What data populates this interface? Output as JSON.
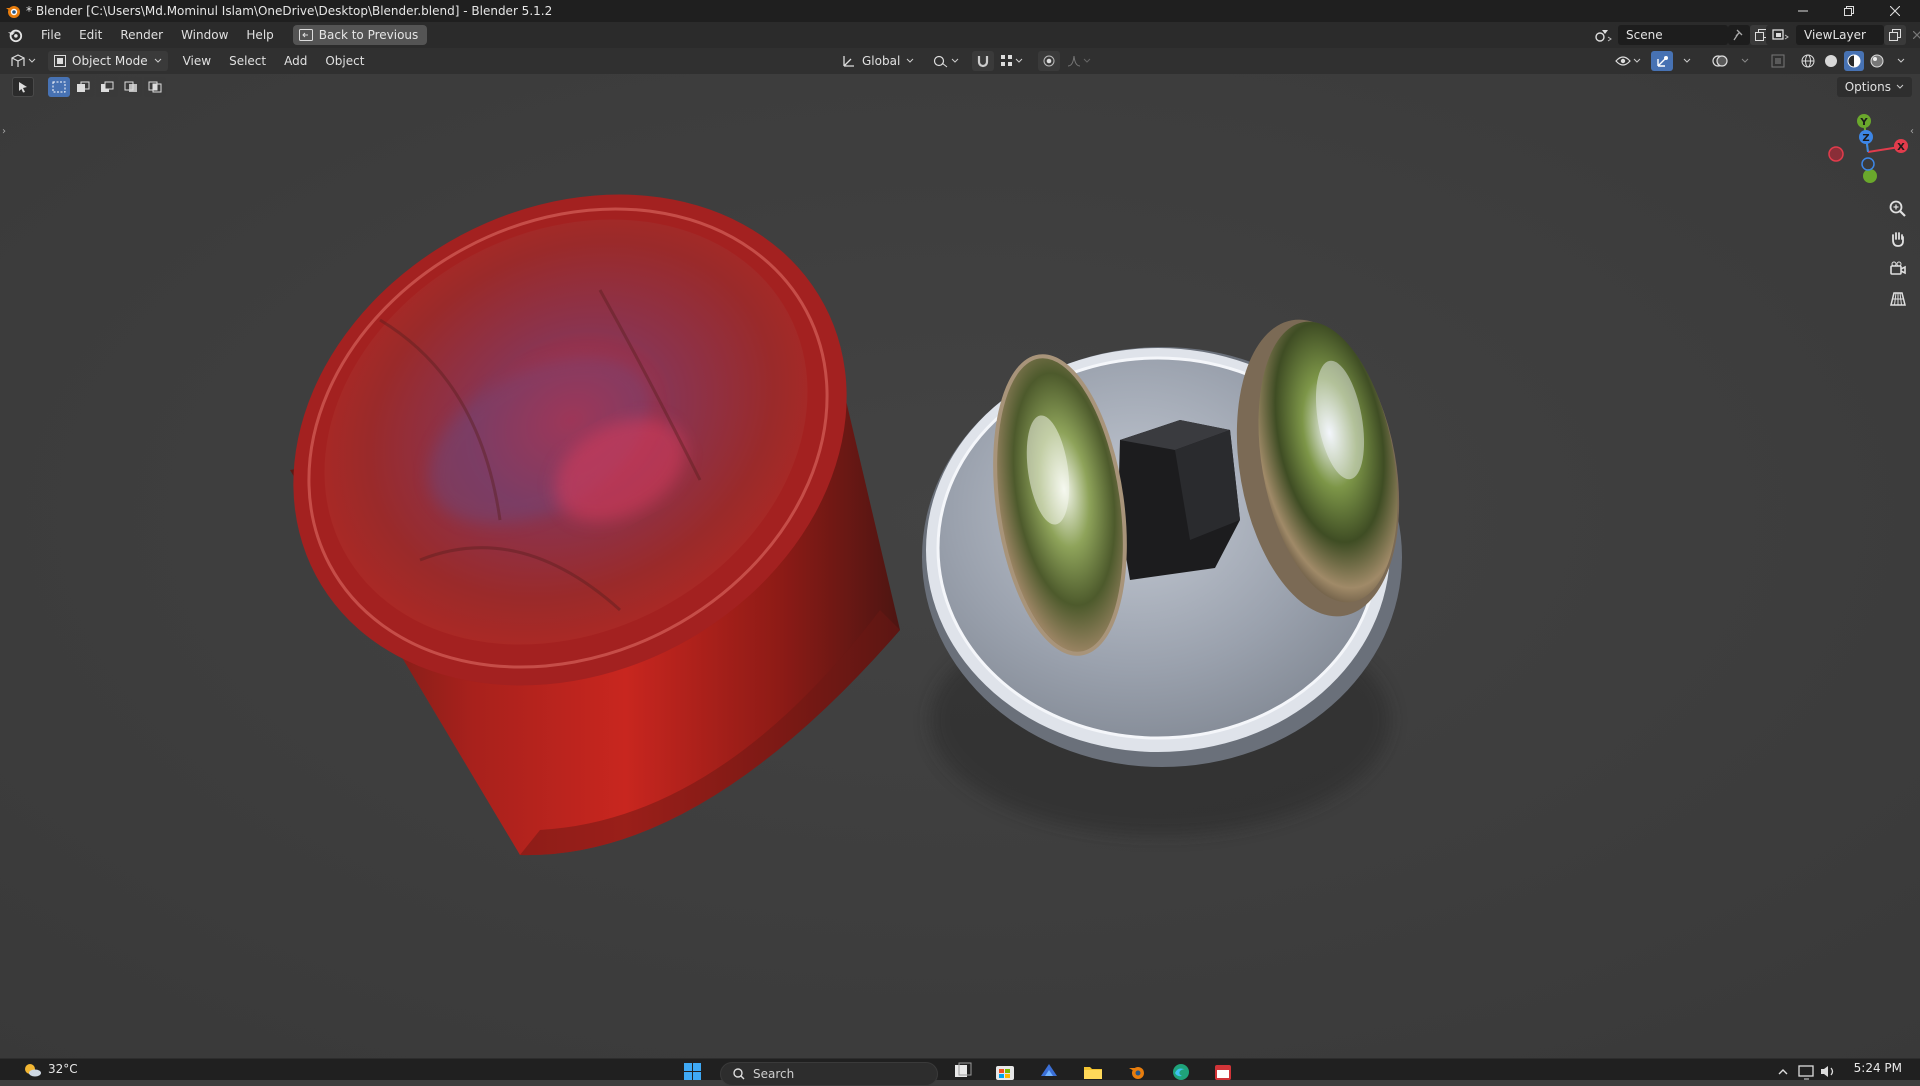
{
  "window": {
    "title": "* Blender [C:\\Users\\Md.Mominul Islam\\OneDrive\\Desktop\\Blender.blend] - Blender 5.1.2"
  },
  "menubar": {
    "items": [
      "File",
      "Edit",
      "Render",
      "Window",
      "Help"
    ],
    "back_button": "Back to Previous",
    "scene_name": "Scene",
    "view_layer": "ViewLayer"
  },
  "viewport_header": {
    "mode": "Object Mode",
    "menus": [
      "View",
      "Select",
      "Add",
      "Object"
    ],
    "transform_orientation": "Global"
  },
  "tool_settings": {
    "options_label": "Options"
  },
  "gizmo": {
    "axes": [
      "Y",
      "Z",
      "X"
    ],
    "colors": {
      "x": "#e23c4c",
      "y": "#6aa82c",
      "z": "#3d86e6"
    }
  },
  "taskbar": {
    "weather": "32°C",
    "search_placeholder": "Search",
    "time": "5:24 PM"
  }
}
